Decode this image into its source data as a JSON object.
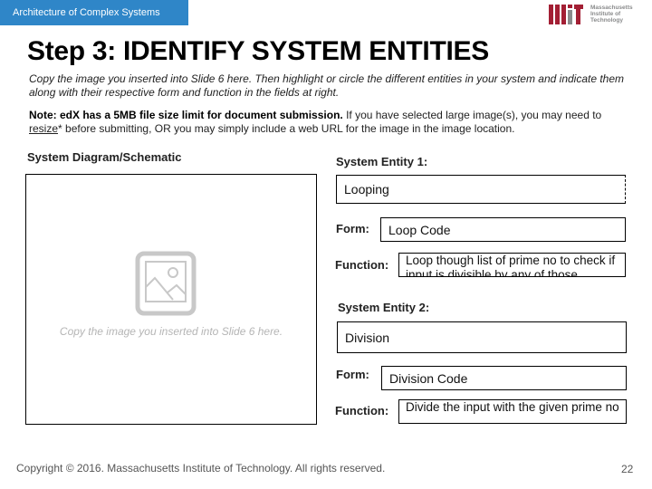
{
  "header": {
    "course_title": "Architecture of Complex Systems",
    "brand_color": "#2f86c8",
    "institution_logo": {
      "icon": "mit-logo-icon",
      "lines": [
        "Massachusetts",
        "Institute of",
        "Technology"
      ],
      "color": "#a31f34"
    }
  },
  "slide": {
    "title": "Step 3: IDENTIFY SYSTEM ENTITIES",
    "instructions": "Copy the image you inserted into Slide 6 here. Then highlight or circle the different entities in your system and indicate them along with their respective form and function in the fields at right.",
    "note_bold": "Note: edX has a 5MB file size limit for document submission.",
    "note_rest_1": " If you have selected large image(s), you may need to ",
    "note_link": "resize",
    "note_rest_2": "* before submitting, OR you may simply include a web URL for the image in the image location."
  },
  "diagram": {
    "label": "System Diagram/Schematic",
    "placeholder_icon": "image-placeholder-icon",
    "placeholder_text": "Copy the image you inserted into Slide 6 here."
  },
  "entities": [
    {
      "label": "System Entity 1:",
      "name": "Looping",
      "form_label": "Form:",
      "form": "Loop Code",
      "function_label": "Function:",
      "function": "Loop though list of prime no to check if input is divisible by any of those"
    },
    {
      "label": "System Entity 2:",
      "name": "Division",
      "form_label": "Form:",
      "form": "Division Code",
      "function_label": "Function:",
      "function": "Divide the input with the given prime no"
    }
  ],
  "footer": {
    "copyright": "Copyright © 2016. Massachusetts Institute of Technology. All rights reserved.",
    "page_number": "22"
  }
}
